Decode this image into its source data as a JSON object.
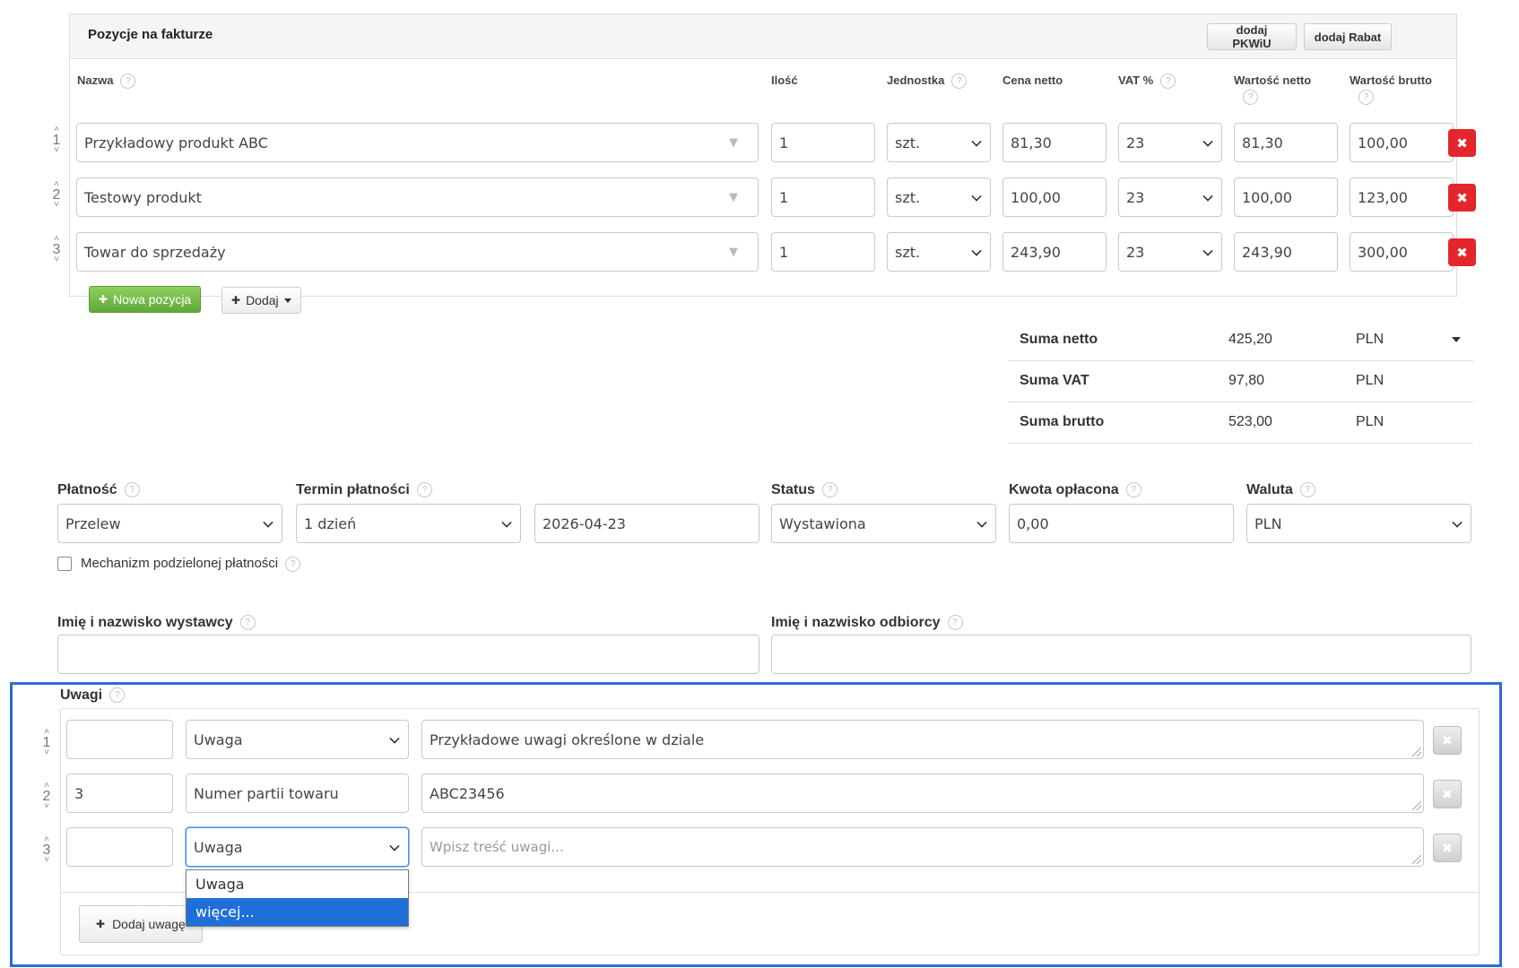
{
  "positions": {
    "title": "Pozycje na fakturze",
    "add_pkwiu": "dodaj PKWiU",
    "add_discount": "dodaj Rabat",
    "columns": {
      "name": "Nazwa",
      "qty": "Ilość",
      "unit": "Jednostka",
      "net_price": "Cena netto",
      "vat": "VAT %",
      "net_value": "Wartość netto",
      "gross_value": "Wartość brutto"
    },
    "rows": [
      {
        "num": "1",
        "name": "Przykładowy produkt ABC",
        "qty": "1",
        "unit": "szt.",
        "net_price": "81,30",
        "vat": "23",
        "net_value": "81,30",
        "gross_value": "100,00"
      },
      {
        "num": "2",
        "name": "Testowy produkt",
        "qty": "1",
        "unit": "szt.",
        "net_price": "100,00",
        "vat": "23",
        "net_value": "100,00",
        "gross_value": "123,00"
      },
      {
        "num": "3",
        "name": "Towar do sprzedaży",
        "qty": "1",
        "unit": "szt.",
        "net_price": "243,90",
        "vat": "23",
        "net_value": "243,90",
        "gross_value": "300,00"
      }
    ],
    "new_item": "Nowa pozycja",
    "add": "Dodaj"
  },
  "totals": [
    {
      "label": "Suma netto",
      "value": "425,20",
      "currency": "PLN"
    },
    {
      "label": "Suma VAT",
      "value": "97,80",
      "currency": "PLN"
    },
    {
      "label": "Suma brutto",
      "value": "523,00",
      "currency": "PLN"
    }
  ],
  "payment": {
    "method_label": "Płatność",
    "method_value": "Przelew",
    "term_label": "Termin płatności",
    "term_value": "1 dzień",
    "due_date": "2026-04-23",
    "status_label": "Status",
    "status_value": "Wystawiona",
    "paid_label": "Kwota opłacona",
    "paid_value": "0,00",
    "currency_label": "Waluta",
    "currency_value": "PLN",
    "split_payment_label": "Mechanizm podzielonej płatności"
  },
  "people": {
    "issuer_label": "Imię i nazwisko wystawcy",
    "issuer_value": "",
    "recipient_label": "Imię i nazwisko odbiorcy",
    "recipient_value": ""
  },
  "notes": {
    "label": "Uwagi",
    "rows": [
      {
        "num": "1",
        "code": "",
        "type": "Uwaga",
        "text": "Przykładowe uwagi określone w dziale"
      },
      {
        "num": "2",
        "code": "3",
        "type": "Numer partii towaru",
        "text": "ABC23456"
      },
      {
        "num": "3",
        "code": "",
        "type": "Uwaga",
        "text": ""
      }
    ],
    "text_placeholder": "Wpisz treść uwagi...",
    "dropdown_options": [
      "Uwaga",
      "więcej..."
    ],
    "add_note": "Dodaj uwagę"
  },
  "icons": {
    "help": "?",
    "remove": "✖",
    "plus": "✚",
    "triangle": "▼",
    "arrow_up": "˄",
    "arrow_down": "˅"
  },
  "colors": {
    "delete_red": "#e3262d",
    "new_item_green": "#6cb944",
    "highlight_blue": "#2f6ad8",
    "option_selected": "#1e6fd8"
  }
}
